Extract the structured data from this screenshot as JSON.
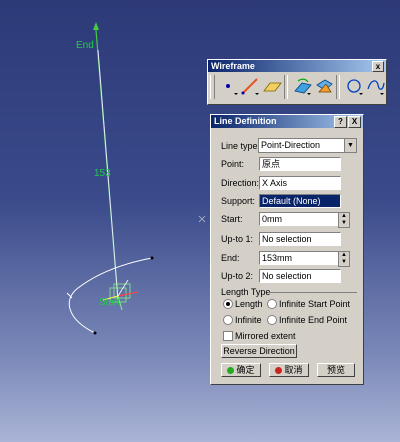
{
  "viewport": {
    "end_label": "End",
    "start_label": "Start",
    "length_label": "153",
    "colors": {
      "line": "#44cc44",
      "background": "#3a4a8a"
    }
  },
  "toolbar": {
    "title": "Wireframe",
    "close": "x",
    "icons": [
      "point-icon",
      "line-icon",
      "plane-icon",
      "projection-icon",
      "intersection-icon",
      "circle-icon",
      "spline-icon"
    ]
  },
  "dialog": {
    "title": "Line Definition",
    "help": "?",
    "close": "X",
    "line_type_label": "Line type :",
    "line_type_value": "Point-Direction",
    "point_label": "Point:",
    "point_value": "原点",
    "direction_label": "Direction:",
    "direction_value": "X Axis",
    "support_label": "Support:",
    "support_value": "Default (None)",
    "start_label": "Start:",
    "start_value": "0mm",
    "upto1_label": "Up-to 1:",
    "upto1_value": "No selection",
    "end_label": "End:",
    "end_value": "153mm",
    "upto2_label": "Up-to 2:",
    "upto2_value": "No selection",
    "length_type_title": "Length Type",
    "length_options": [
      {
        "label": "Length",
        "selected": true
      },
      {
        "label": "Infinite Start Point",
        "selected": false
      },
      {
        "label": "Infinite",
        "selected": false
      },
      {
        "label": "Infinite End Point",
        "selected": false
      }
    ],
    "mirrored_label": "Mirrored extent",
    "mirrored_checked": false,
    "reverse_label": "Reverse Direction",
    "ok_label": "确定",
    "cancel_label": "取消",
    "preview_label": "预览"
  }
}
